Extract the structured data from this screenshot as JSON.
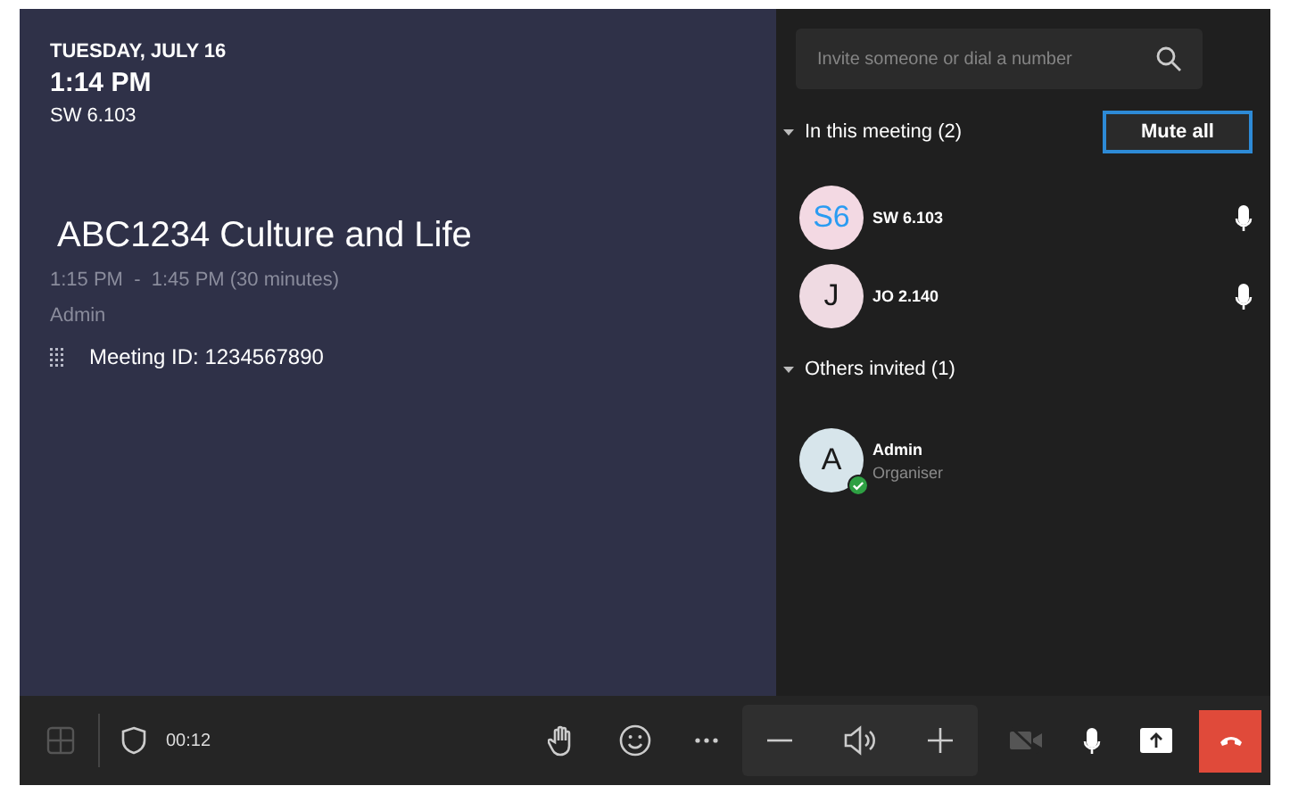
{
  "header": {
    "date": "TUESDAY, JULY 16",
    "time": "1:14 PM",
    "room": "SW 6.103"
  },
  "meeting": {
    "title": "ABC1234 Culture and Life",
    "timespan": "1:15 PM  -  1:45 PM (30 minutes)",
    "organizer": "Admin",
    "meeting_id": "Meeting ID: 1234567890"
  },
  "roster": {
    "search": {
      "placeholder": "Invite someone or dial a number"
    },
    "mute_all": "Mute all",
    "sections": [
      {
        "title": "In this meeting (2)",
        "expanded": true,
        "people": [
          {
            "initials": "S6",
            "name": "SW 6.103",
            "color": "#f3d9e3",
            "accent": true,
            "mic": true
          },
          {
            "initials": "J",
            "name": "JO 2.140",
            "color": "#efdae2",
            "accent": false,
            "mic": true
          }
        ]
      },
      {
        "title": "Others invited (1)",
        "expanded": true,
        "people": [
          {
            "initials": "A",
            "name": "Admin",
            "role": "Organiser",
            "color": "#d7e5eb",
            "accent": false,
            "mic": false,
            "accepted": true
          }
        ]
      }
    ]
  },
  "callbar": {
    "duration": "00:12",
    "camera_on": false
  }
}
